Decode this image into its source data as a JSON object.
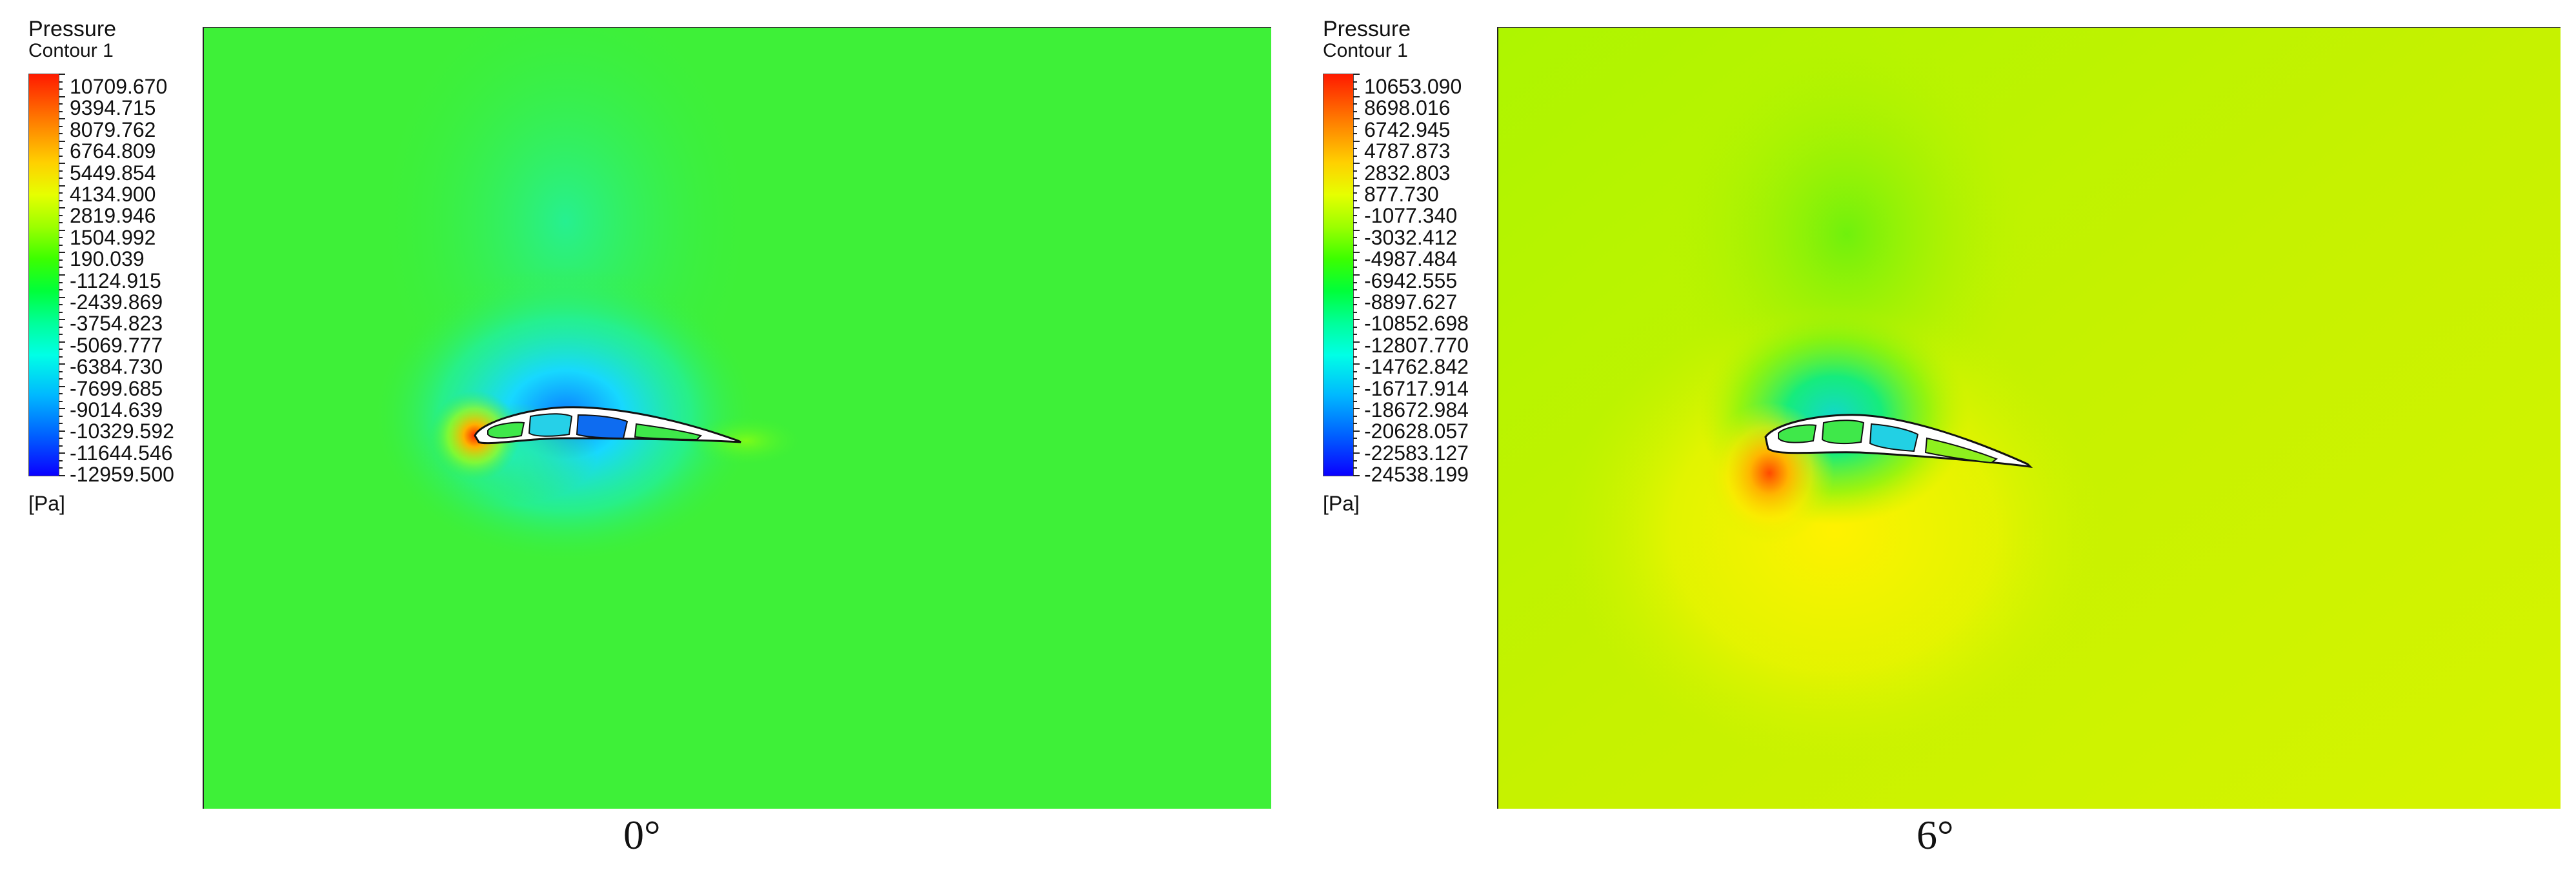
{
  "panels": [
    {
      "legend": {
        "title": "Pressure",
        "subtitle": "Contour 1",
        "unit": "[Pa]",
        "values": [
          "10709.670",
          "9394.715",
          "8079.762",
          "6764.809",
          "5449.854",
          "4134.900",
          "2819.946",
          "1504.992",
          "190.039",
          "-1124.915",
          "-2439.869",
          "-3754.823",
          "-5069.777",
          "-6384.730",
          "-7699.685",
          "-9014.639",
          "-10329.592",
          "-11644.546",
          "-12959.500"
        ]
      },
      "angle_label": "0°",
      "colors": {
        "background": "#3cf236",
        "suction": "#1fd8ff",
        "cell_dark": "#0e6cf0"
      }
    },
    {
      "legend": {
        "title": "Pressure",
        "subtitle": "Contour 1",
        "unit": "[Pa]",
        "values": [
          "10653.090",
          "8698.016",
          "6742.945",
          "4787.873",
          "2832.803",
          "877.730",
          "-1077.340",
          "-3032.412",
          "-4987.484",
          "-6942.555",
          "-8897.627",
          "-10852.698",
          "-12807.770",
          "-14762.842",
          "-16717.914",
          "-18672.984",
          "-20628.057",
          "-22583.127",
          "-24538.199"
        ]
      },
      "angle_label": "6°",
      "colors": {
        "background": "#c8f500",
        "suction": "#14e4a8",
        "cell_dark": "#22d0e4"
      }
    }
  ]
}
